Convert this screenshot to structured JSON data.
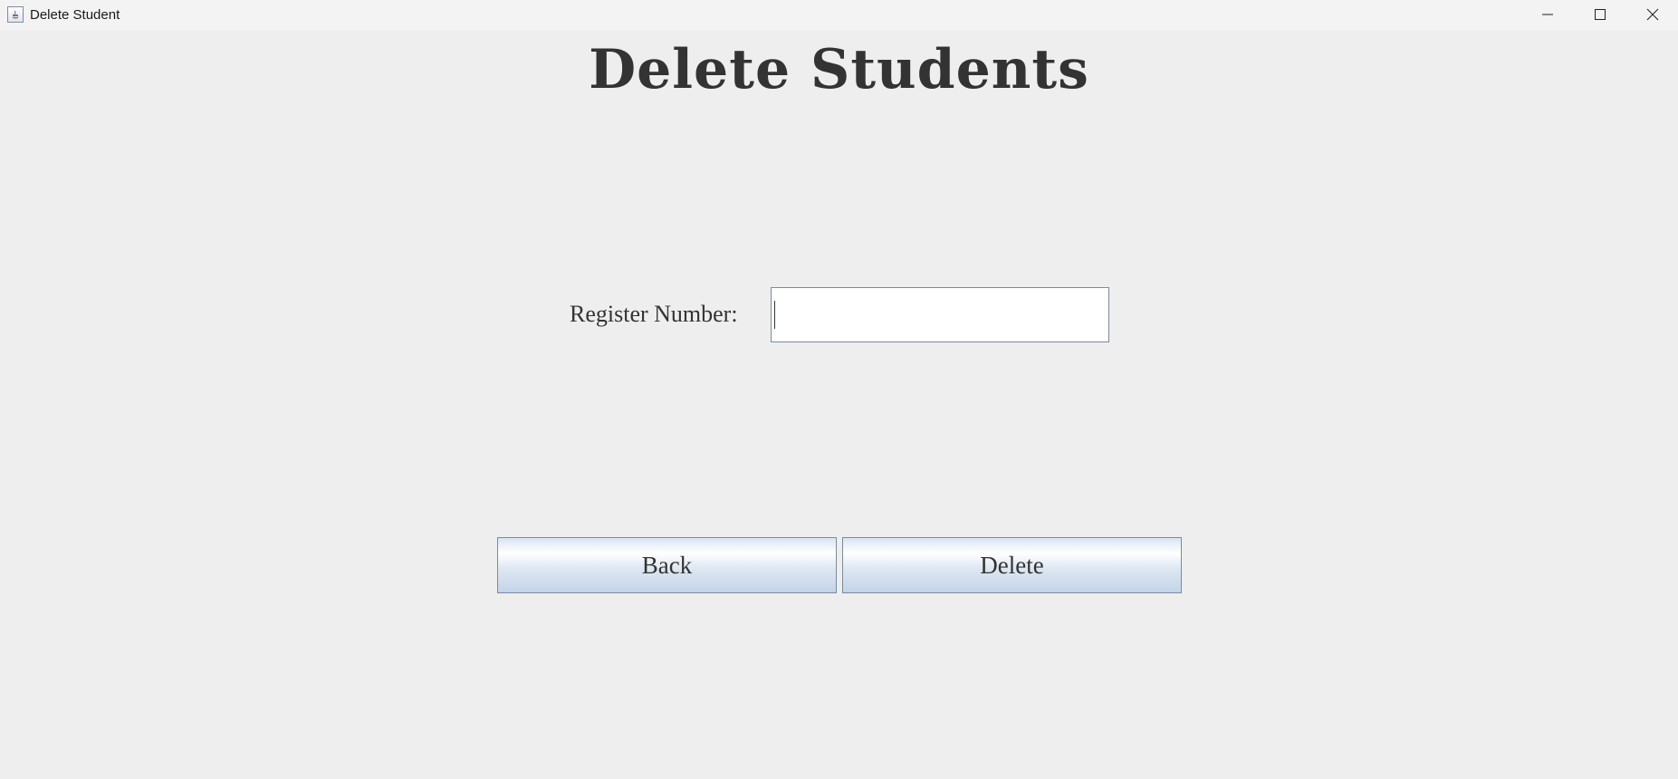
{
  "window": {
    "title": "Delete Student",
    "controls": [
      "minimize-icon",
      "maximize-icon",
      "close-icon"
    ]
  },
  "main": {
    "heading": "Delete Students",
    "register_label": "Register Number:",
    "register_value": ""
  },
  "buttons": {
    "back_label": "Back",
    "delete_label": "Delete"
  },
  "colors": {
    "background": "#eeeeee",
    "text": "#333333",
    "button_border": "#7a8a9c"
  }
}
